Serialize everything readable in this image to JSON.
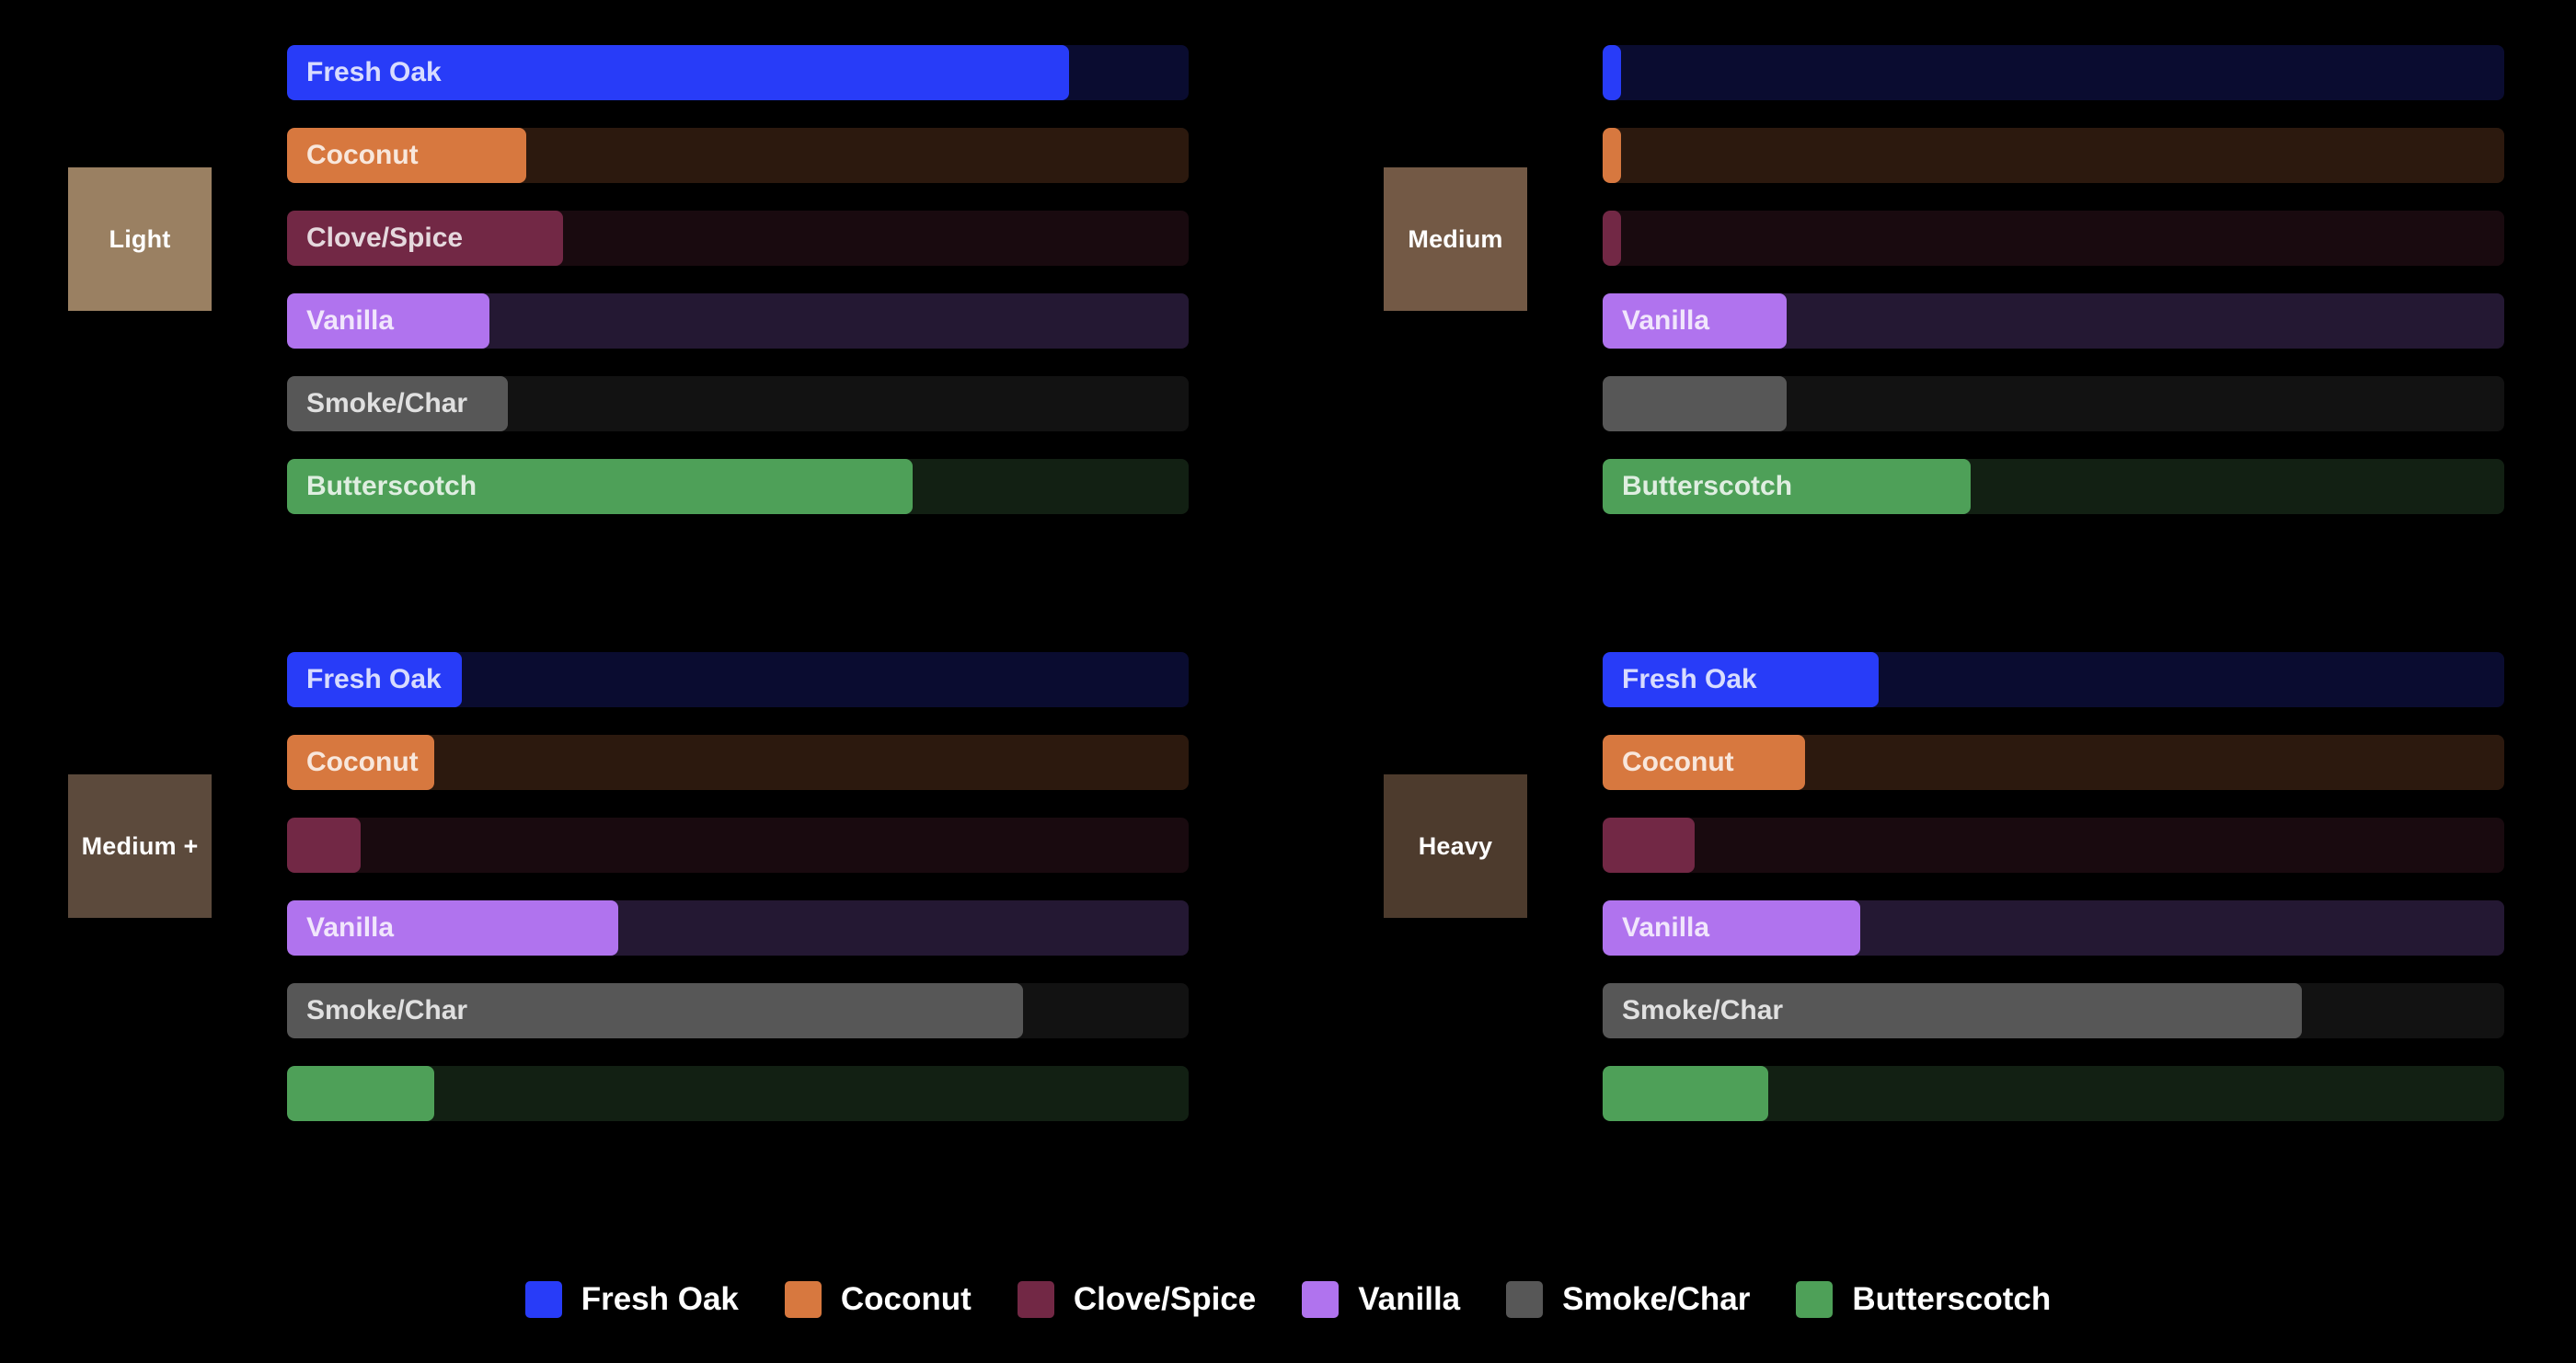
{
  "chart_data": {
    "type": "bar",
    "orientation": "horizontal",
    "title": "",
    "xlabel": "",
    "ylabel": "",
    "value_unit": "percent of track",
    "xlim": [
      0,
      100
    ],
    "grid": false,
    "legend_position": "bottom-center",
    "flavors": [
      {
        "name": "Fresh Oak",
        "color": "#283CF8",
        "track_color": "#0A0C30"
      },
      {
        "name": "Coconut",
        "color": "#D7783F",
        "track_color": "#2C190E"
      },
      {
        "name": "Clove/Spice",
        "color": "#722845",
        "track_color": "#190A0F"
      },
      {
        "name": "Vanilla",
        "color": "#B073EE",
        "track_color": "#241833"
      },
      {
        "name": "Smoke/Char",
        "color": "#575757",
        "track_color": "#121212"
      },
      {
        "name": "Butterscotch",
        "color": "#4EA058",
        "track_color": "#122013"
      }
    ],
    "panels": [
      {
        "category": "Light",
        "tile_color": "#9A8062",
        "values": [
          86.7,
          26.5,
          30.6,
          22.4,
          24.5,
          69.4
        ],
        "show_labels": [
          true,
          true,
          true,
          true,
          true,
          true
        ]
      },
      {
        "category": "Medium",
        "tile_color": "#735945",
        "values": [
          2.0,
          2.0,
          2.0,
          20.4,
          20.4,
          40.8
        ],
        "show_labels": [
          false,
          false,
          false,
          true,
          false,
          true
        ]
      },
      {
        "category": "Medium +",
        "tile_color": "#5C4A3C",
        "values": [
          19.4,
          16.3,
          8.2,
          36.7,
          81.6,
          16.3
        ],
        "show_labels": [
          true,
          true,
          false,
          true,
          true,
          false
        ]
      },
      {
        "category": "Heavy",
        "tile_color": "#4D3B2D",
        "values": [
          30.6,
          22.4,
          10.2,
          28.6,
          77.6,
          18.4
        ],
        "show_labels": [
          true,
          true,
          false,
          true,
          true,
          false
        ]
      }
    ],
    "legend": [
      "Fresh Oak",
      "Coconut",
      "Clove/Spice",
      "Vanilla",
      "Smoke/Char",
      "Butterscotch"
    ]
  }
}
